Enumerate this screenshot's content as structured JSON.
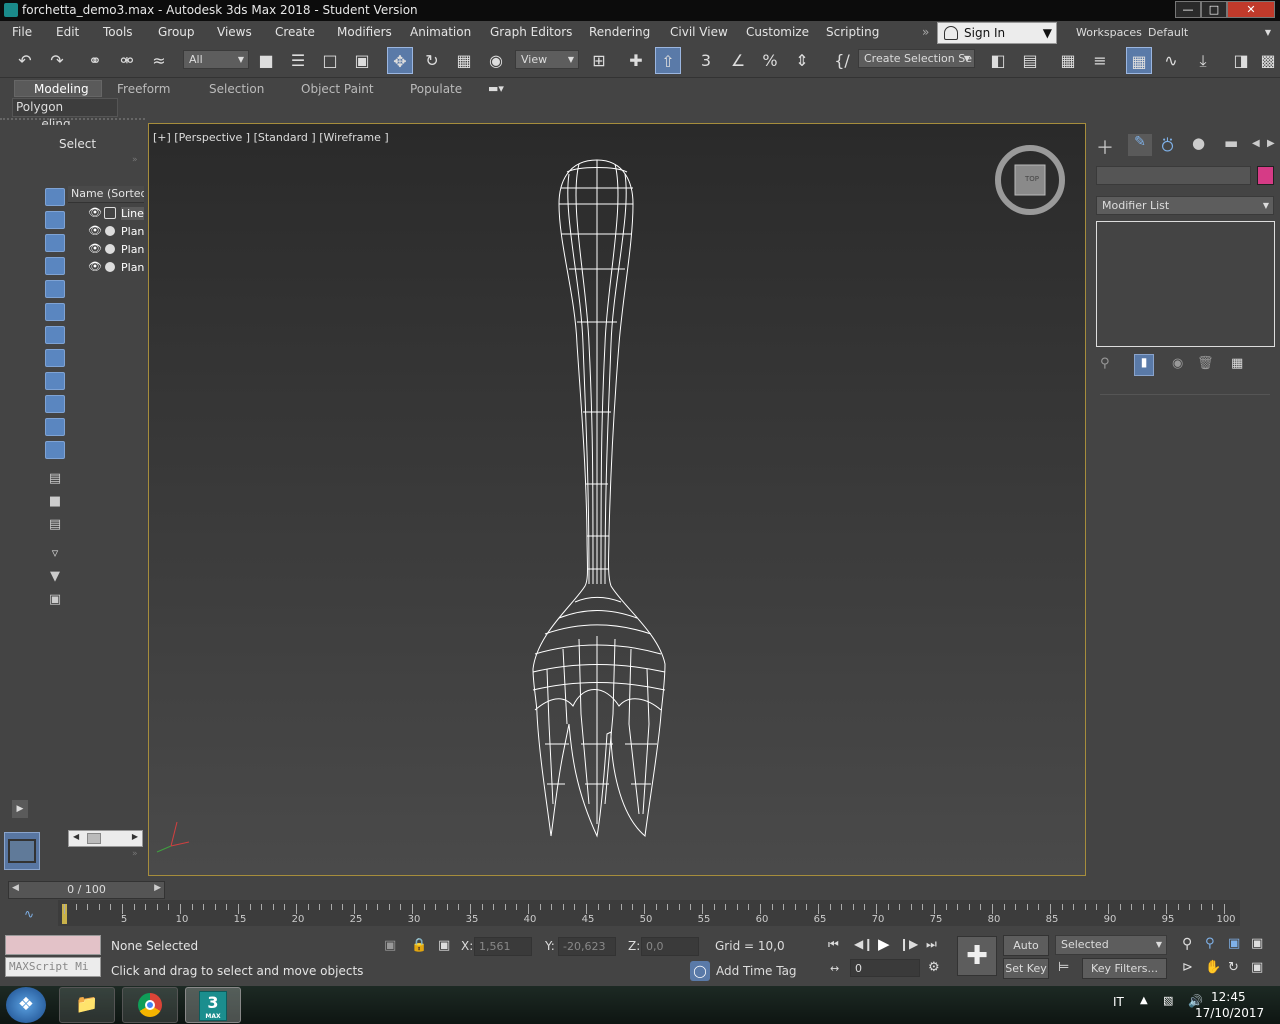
{
  "window": {
    "title": "forchetta_demo3.max - Autodesk 3ds Max 2018 - Student Version"
  },
  "menu": [
    "File",
    "Edit",
    "Tools",
    "Group",
    "Views",
    "Create",
    "Modifiers",
    "Animation",
    "Graph Editors",
    "Rendering",
    "Civil View",
    "Customize",
    "Scripting"
  ],
  "signin": {
    "label": "Sign In"
  },
  "workspaces": {
    "label": "Workspaces:",
    "value": "Default"
  },
  "toolbar": {
    "filter": "All",
    "refcoord": "View",
    "selection_set": "Create Selection Se"
  },
  "ribbon": {
    "tabs": [
      "Modeling",
      "Freeform",
      "Selection",
      "Object Paint",
      "Populate"
    ],
    "sub": "Polygon Modeling"
  },
  "scene_explorer": {
    "header": "Select",
    "column": "Name (Sorted A",
    "items": [
      "Line",
      "Plan",
      "Plan",
      "Plan"
    ]
  },
  "viewport": {
    "label": "[+] [Perspective ] [Standard ] [Wireframe ]",
    "viewcube_face": "TOP"
  },
  "command_panel": {
    "modifier_list": "Modifier List",
    "accent": "#d63b86"
  },
  "timeline": {
    "frame": "0 / 100",
    "ticks": [
      "0",
      "5",
      "10",
      "15",
      "20",
      "25",
      "30",
      "35",
      "40",
      "45",
      "50",
      "55",
      "60",
      "65",
      "70",
      "75",
      "80",
      "85",
      "90",
      "95",
      "100"
    ]
  },
  "status": {
    "selection": "None Selected",
    "prompt": "Click and drag to select and move objects",
    "maxscript": "MAXScript Mi",
    "x_label": "X:",
    "x": "1,561",
    "y_label": "Y:",
    "y": "-20,623",
    "z_label": "Z:",
    "z": "0,0",
    "grid": "Grid = 10,0",
    "add_time_tag": "Add Time Tag",
    "auto_key": "Auto Key",
    "set_key": "Set Key",
    "key_mode": "Selected",
    "key_filters": "Key Filters...",
    "current_frame": "0"
  },
  "taskbar": {
    "lang": "IT",
    "time": "12:45",
    "date": "17/10/2017",
    "max_label": "MAX"
  }
}
